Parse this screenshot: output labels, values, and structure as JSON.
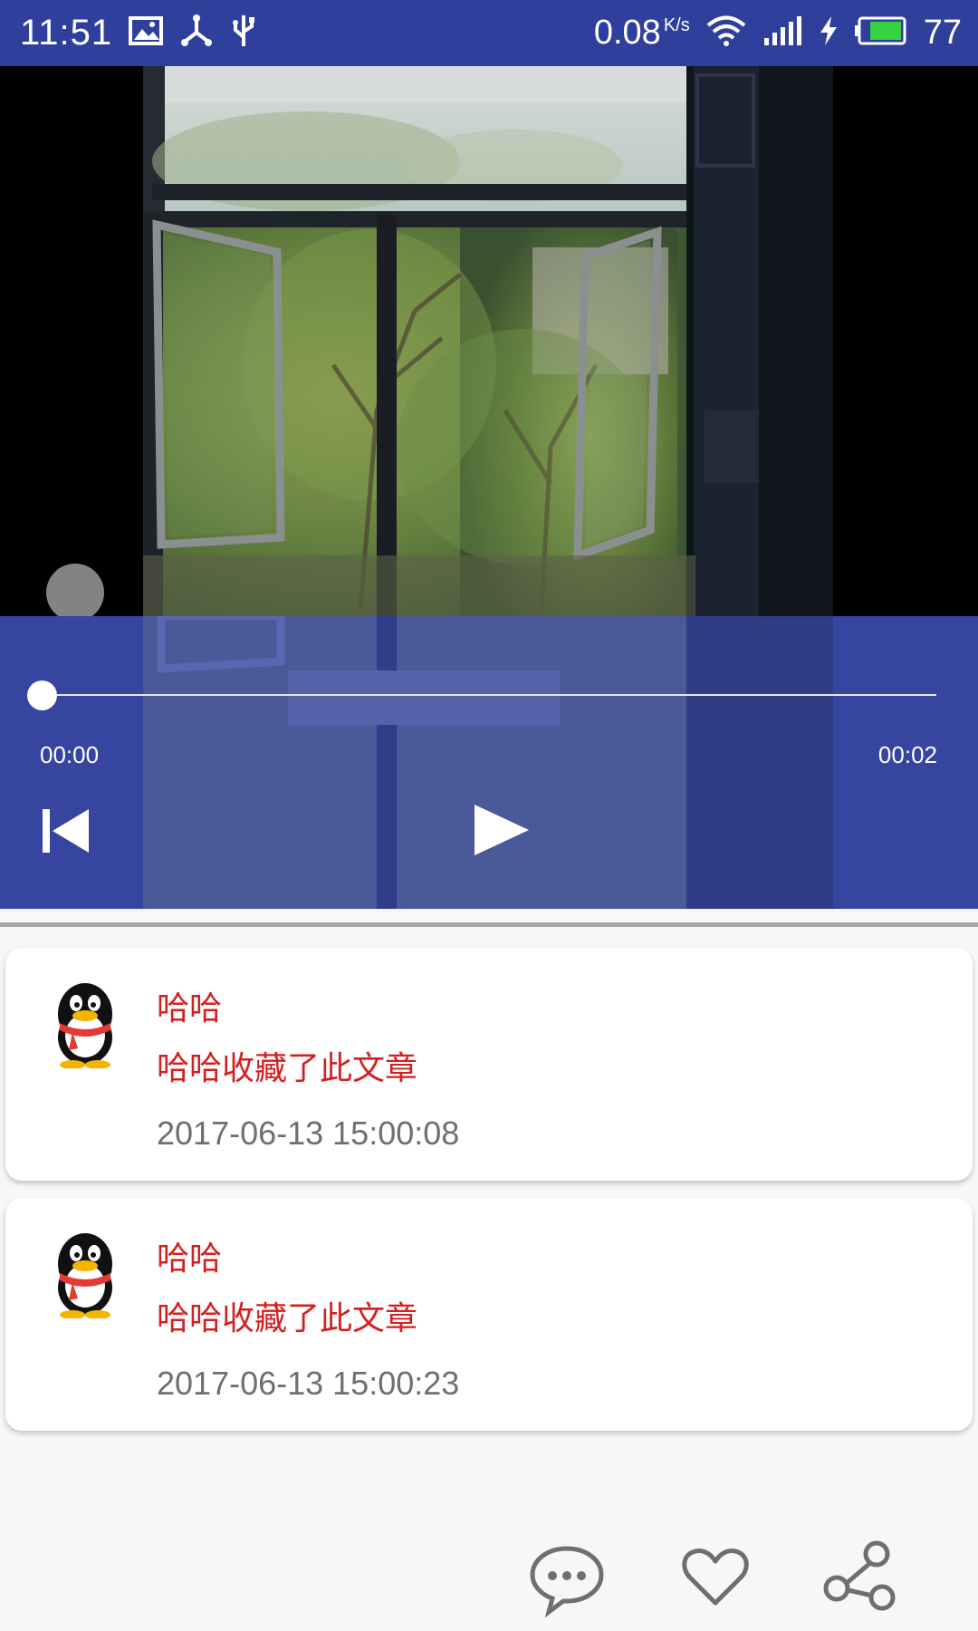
{
  "status_bar": {
    "time": "11:51",
    "net_speed": "0.08",
    "net_unit": "K/s",
    "battery": "77"
  },
  "player": {
    "current_time": "00:00",
    "total_time": "00:02",
    "progress_fraction": 0,
    "accent_color": "#2f3f9c"
  },
  "comments": [
    {
      "name": "哈哈",
      "text": "哈哈收藏了此文章",
      "time": "2017-06-13 15:00:08"
    },
    {
      "name": "哈哈",
      "text": "哈哈收藏了此文章",
      "time": "2017-06-13 15:00:23"
    }
  ],
  "action_bar": {
    "icons": [
      "comment-icon",
      "heart-icon",
      "share-icon"
    ]
  },
  "colors": {
    "comment_name": "#d41f1f",
    "comment_time": "#6f6f6f"
  }
}
